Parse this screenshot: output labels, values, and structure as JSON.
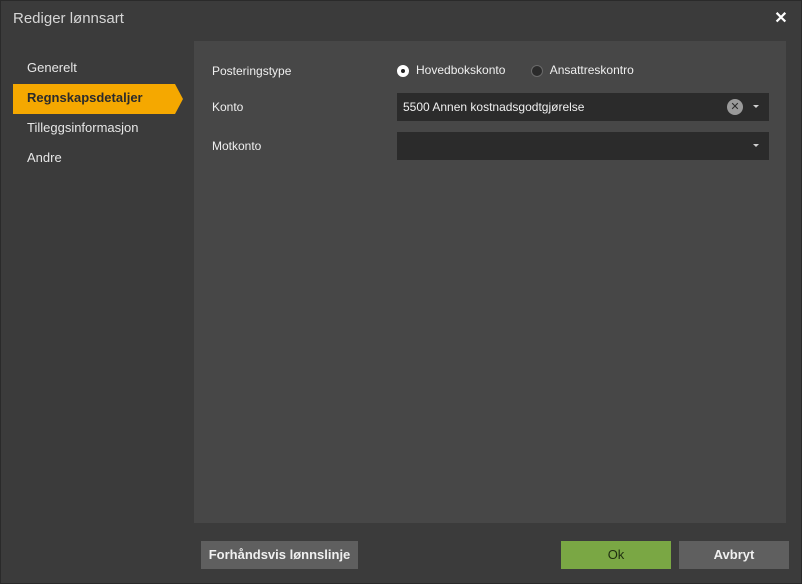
{
  "window": {
    "title": "Rediger lønnsart"
  },
  "nav": {
    "items": [
      {
        "label": "Generelt"
      },
      {
        "label": "Regnskapsdetaljer"
      },
      {
        "label": "Tilleggsinformasjon"
      },
      {
        "label": "Andre"
      }
    ]
  },
  "form": {
    "posteringstype": {
      "label": "Posteringstype",
      "options": [
        "Hovedbokskonto",
        "Ansattreskontro"
      ],
      "selected": "Hovedbokskonto"
    },
    "konto": {
      "label": "Konto",
      "value": "5500 Annen kostnadsgodtgjørelse"
    },
    "motkonto": {
      "label": "Motkonto",
      "value": ""
    }
  },
  "footer": {
    "preview_label": "Forhåndsvis lønnslinje",
    "ok_label": "Ok",
    "cancel_label": "Avbryt"
  },
  "colors": {
    "accent": "#f5a800",
    "ok": "#7aa744"
  }
}
